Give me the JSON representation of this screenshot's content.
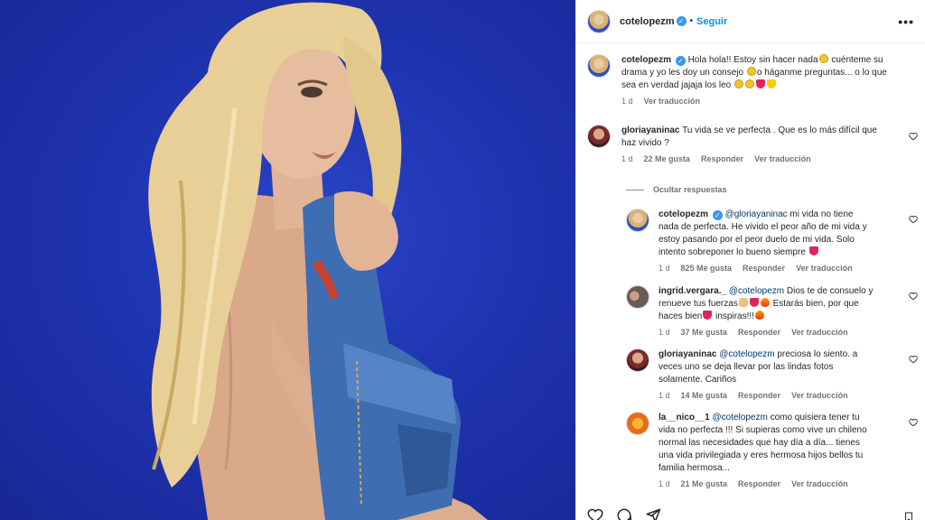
{
  "post": {
    "author": "cotelopezm",
    "follow_label": "Seguir",
    "separator": "•",
    "more_label": "•••",
    "photo_alt": "Fotografía de la publicación"
  },
  "caption": {
    "user": "cotelopezm",
    "part1": "Hola hola!! Estoy sin hacer nada",
    "part2": " cuénteme su drama y yo les doy un consejo ",
    "part3": "o háganme preguntas... o lo que sea en verdad jajaja los leo ",
    "time": "1 d",
    "translate": "Ver traducción"
  },
  "comments": [
    {
      "user": "gloriayaninac",
      "text": "Tu vida se ve perfecta . Que es lo más difícil que haz vivido ?",
      "time": "1 d",
      "likes": "22 Me gusta",
      "reply": "Responder",
      "translate": "Ver traducción"
    }
  ],
  "hide_replies_label": "Ocultar respuestas",
  "replies": [
    {
      "user": "cotelopezm",
      "mention": "@gloriayaninac",
      "text": " mi vida no tiene nada de perfecta. He vivido el peor año de mi vida y estoy pasando por el peor duelo de mi vida. Solo intento sobreponer lo bueno siempre ",
      "time": "1 d",
      "likes": "825 Me gusta",
      "reply": "Responder",
      "translate": "Ver traducción"
    },
    {
      "user": "ingrid.vergara._",
      "mention": "@cotelopezm",
      "text_a": " Dios te de consuelo y renueve tus fuerzas",
      "text_b": " Estarás bien, por que haces bien",
      "text_c": " inspiras!!!",
      "time": "1 d",
      "likes": "37 Me gusta",
      "reply": "Responder",
      "translate": "Ver traducción"
    },
    {
      "user": "gloriayaninac",
      "mention": "@cotelopezm",
      "text": " preciosa lo siento. a veces uno se deja llevar por las lindas fotos solamente. Cariños",
      "time": "1 d",
      "likes": "14 Me gusta",
      "reply": "Responder",
      "translate": "Ver traducción"
    },
    {
      "user": "la__nico__1",
      "mention": "@cotelopezm",
      "text": " como quisiera tener tu vida no perfecta !!! Si supieras como vive un chileno normal las necesidades que hay día a día... tienes una vida privilegiada y eres hermosa hijos bellos tu familia hermosa...",
      "time": "1 d",
      "likes": "21 Me gusta",
      "reply": "Responder",
      "translate": "Ver traducción"
    }
  ],
  "colors": {
    "link_blue": "#0095f6",
    "mention_blue": "#00376b",
    "muted": "#737373",
    "photo_background": "#1f34b0"
  },
  "icons": [
    "verified-badge-icon",
    "more-options-icon",
    "heart-icon",
    "comment-icon",
    "share-icon",
    "bookmark-icon"
  ]
}
